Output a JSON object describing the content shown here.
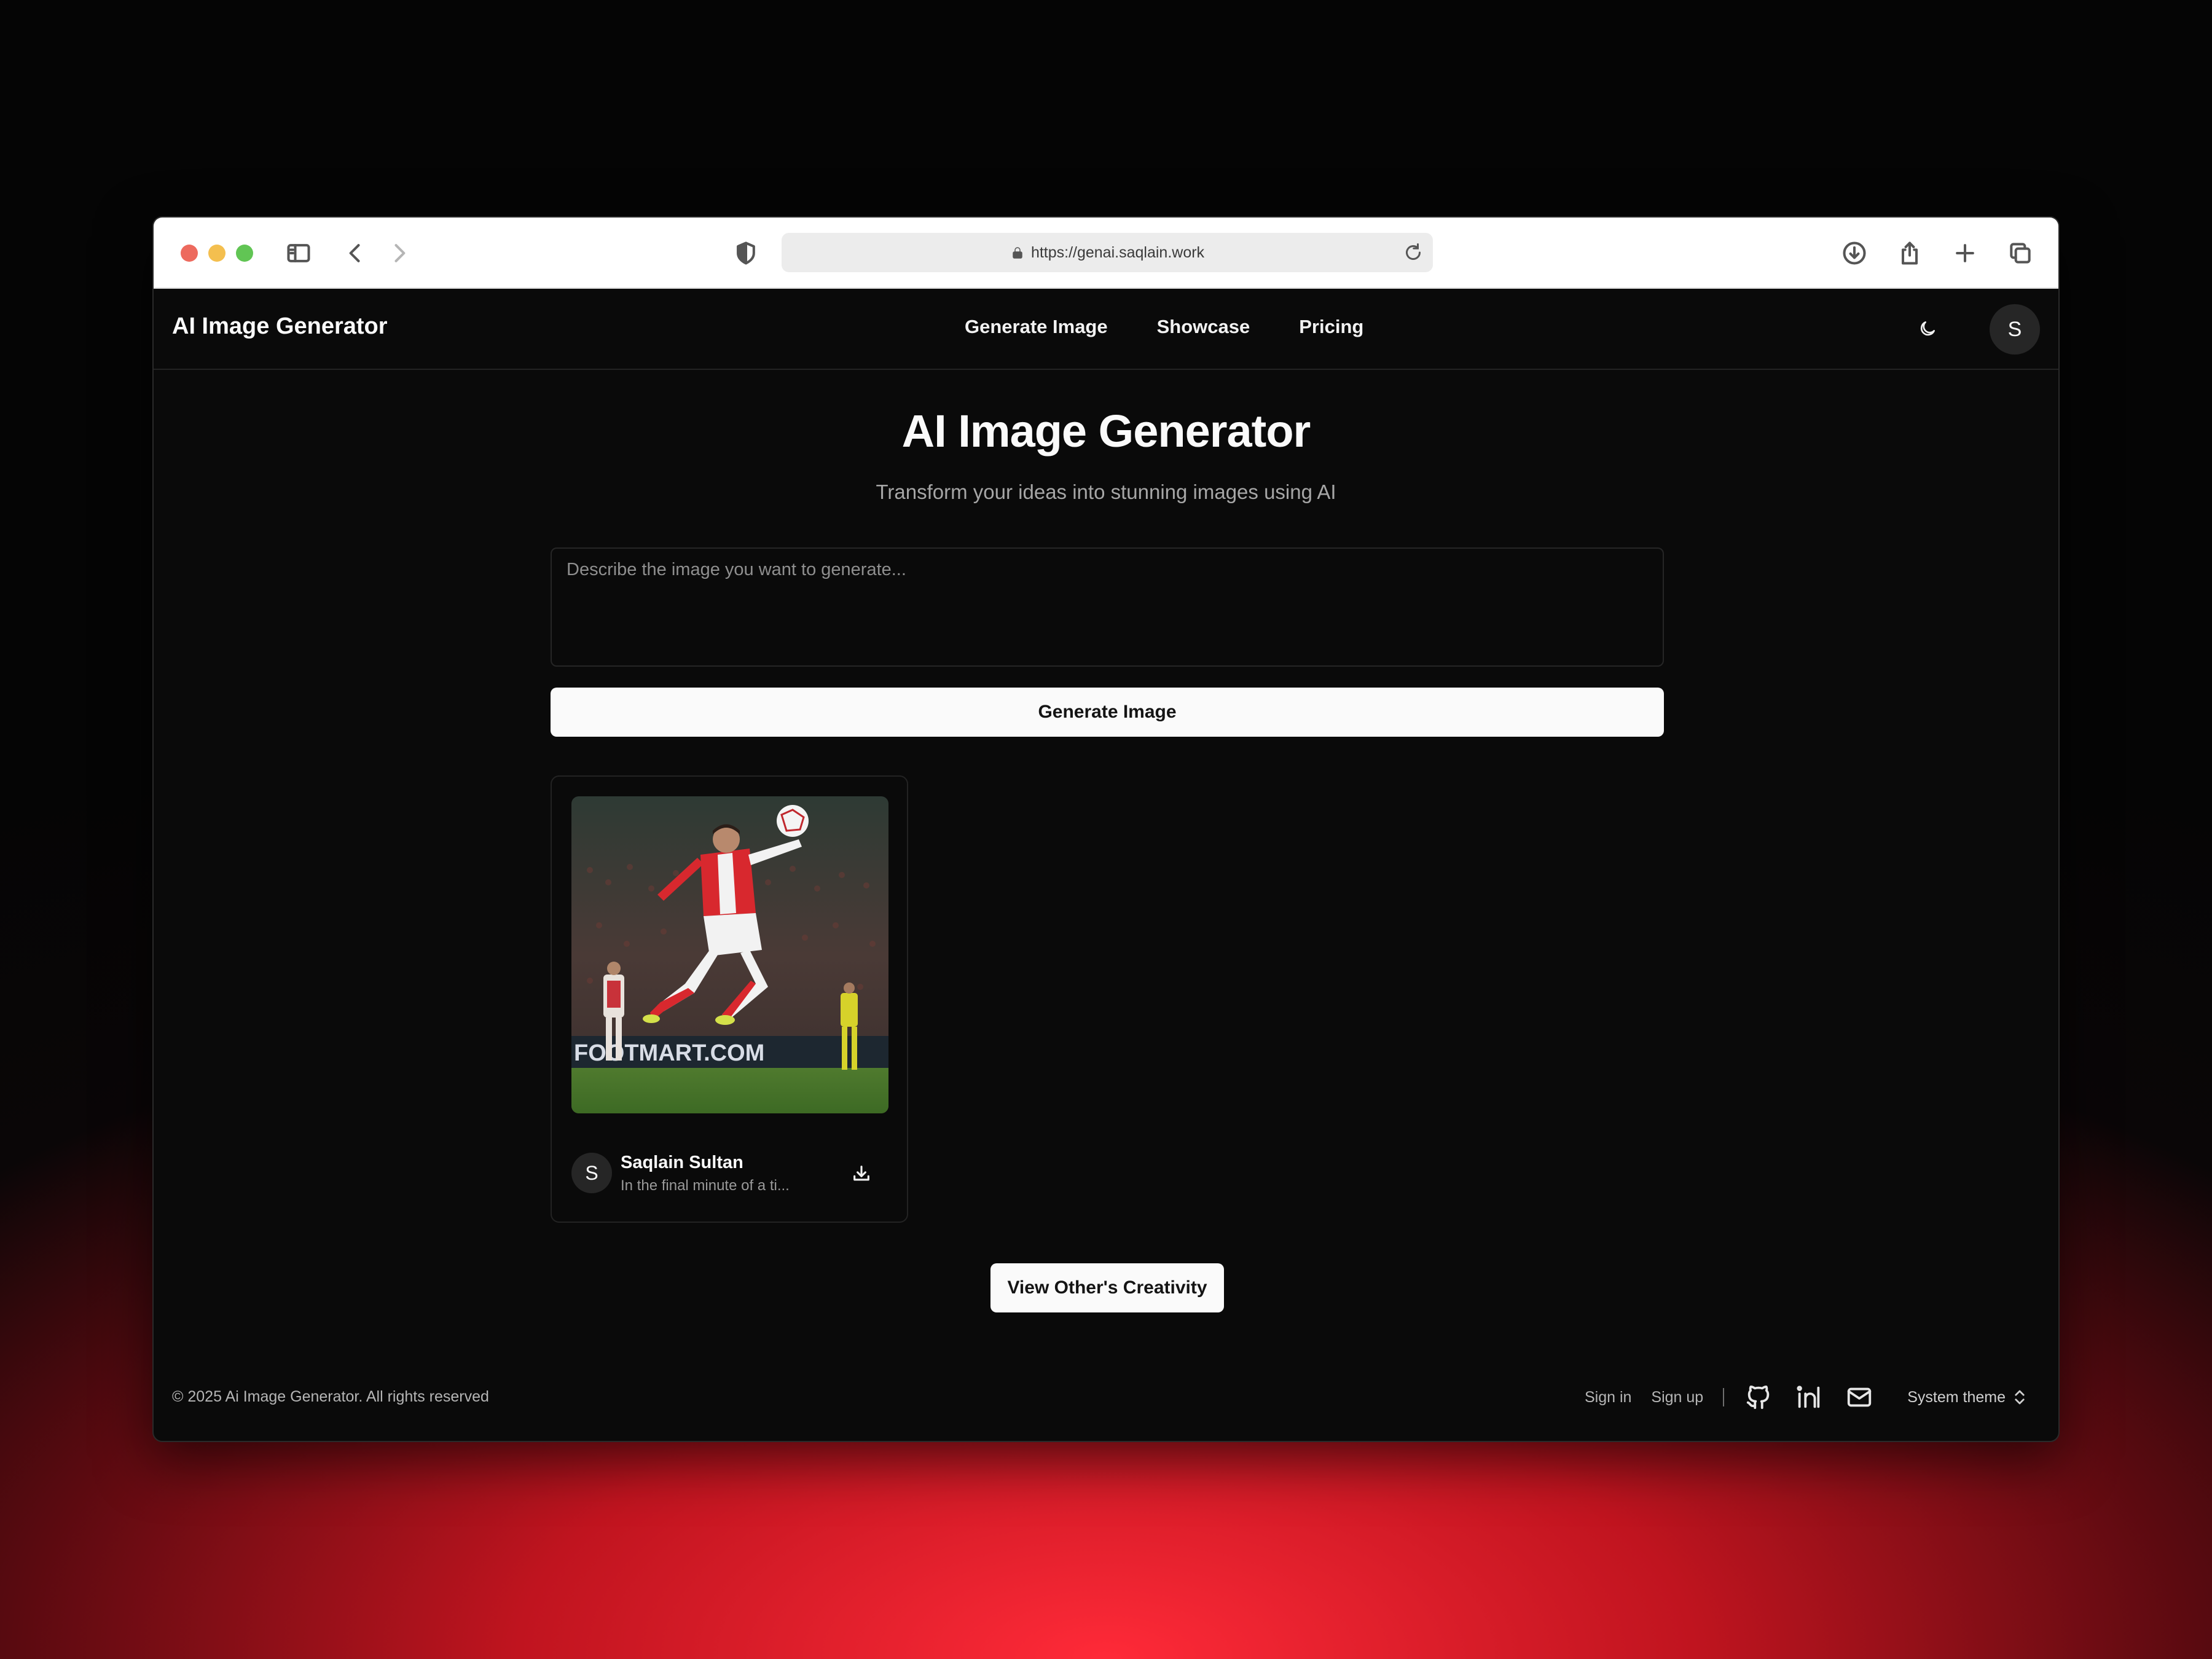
{
  "browser": {
    "url": "https://genai.saqlain.work",
    "icons": [
      "sidebar-icon",
      "back-icon",
      "forward-icon",
      "shield-icon",
      "lock-icon",
      "reload-icon",
      "download-icon",
      "share-icon",
      "new-tab-icon",
      "tabs-overview-icon"
    ]
  },
  "header": {
    "brand": "AI Image Generator",
    "nav": [
      "Generate Image",
      "Showcase",
      "Pricing"
    ],
    "theme_icon": "moon-icon",
    "avatar_initial": "S"
  },
  "main": {
    "title": "AI Image Generator",
    "subtitle": "Transform your ideas into stunning images using AI",
    "prompt_placeholder": "Describe the image you want to generate...",
    "prompt_value": "",
    "generate_label": "Generate Image",
    "cards": [
      {
        "avatar_initial": "S",
        "user": "Saqlain Sultan",
        "prompt_preview": "In the final minute of a ti...",
        "image_text": "FOOTMART.COM",
        "action_icon": "download-icon"
      }
    ],
    "view_more_label": "View Other's Creativity"
  },
  "footer": {
    "copyright": "© 2025 Ai Image Generator. All rights reserved",
    "sign_in": "Sign in",
    "sign_up": "Sign up",
    "social_icons": [
      "github-icon",
      "linkedin-icon",
      "mail-icon"
    ],
    "theme_label": "System theme"
  },
  "colors": {
    "page_bg": "#0a0a0a",
    "text_primary": "#fafafa",
    "text_muted": "#a6a6a6",
    "border": "#262626",
    "button_bg": "#fafafa",
    "backdrop_accent": "#ff2a38"
  }
}
